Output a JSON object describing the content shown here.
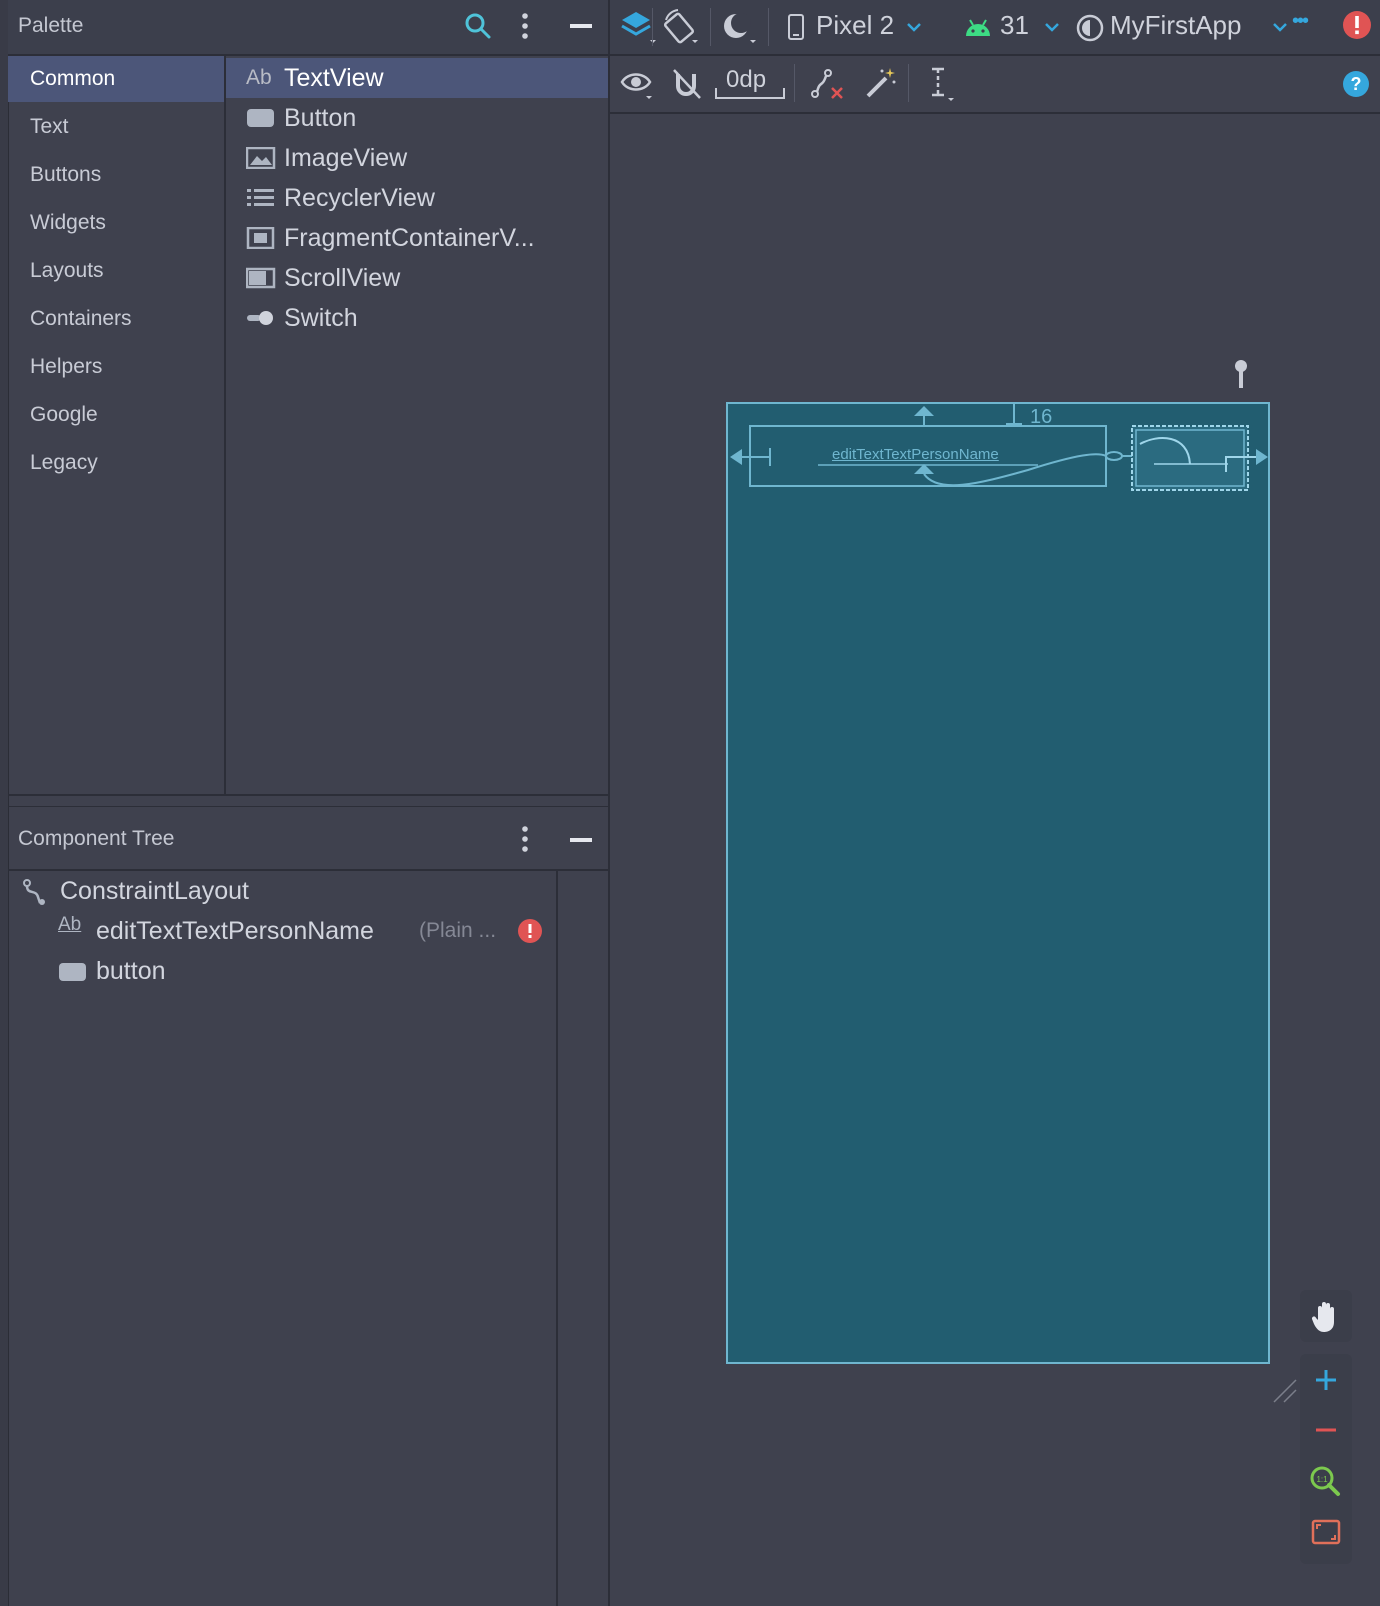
{
  "palette": {
    "title": "Palette",
    "categories": [
      "Common",
      "Text",
      "Buttons",
      "Widgets",
      "Layouts",
      "Containers",
      "Helpers",
      "Google",
      "Legacy"
    ],
    "selected_category": "Common",
    "components": [
      {
        "label": "TextView",
        "icon": "textview-icon"
      },
      {
        "label": "Button",
        "icon": "button-icon"
      },
      {
        "label": "ImageView",
        "icon": "imageview-icon"
      },
      {
        "label": "RecyclerView",
        "icon": "recyclerview-icon"
      },
      {
        "label": "FragmentContainerV...",
        "icon": "fragment-container-icon"
      },
      {
        "label": "ScrollView",
        "icon": "scrollview-icon"
      },
      {
        "label": "Switch",
        "icon": "switch-icon"
      }
    ],
    "textview_prefix": "Ab"
  },
  "component_tree": {
    "title": "Component Tree",
    "root": "ConstraintLayout",
    "children": [
      {
        "name": "editTextTextPersonName",
        "hint": "(Plain ...",
        "icon_text": "Ab",
        "has_error": true
      },
      {
        "name": "button",
        "hint": "",
        "icon_text": "",
        "has_error": false
      }
    ]
  },
  "design_toolbar": {
    "device": "Pixel 2",
    "api_level": "31",
    "theme": "MyFirstApp",
    "more": "•••",
    "default_margin": "0dp"
  },
  "blueprint": {
    "edit_text_label": "editTextTextPersonName",
    "margin_label": "16"
  },
  "colors": {
    "accent_blue": "#35a7dd",
    "android_green": "#3ddc84",
    "error_red": "#e05454",
    "selection": "#4c5679",
    "blueprint_bg": "#225d70",
    "blueprint_line": "#6fb6cf"
  }
}
